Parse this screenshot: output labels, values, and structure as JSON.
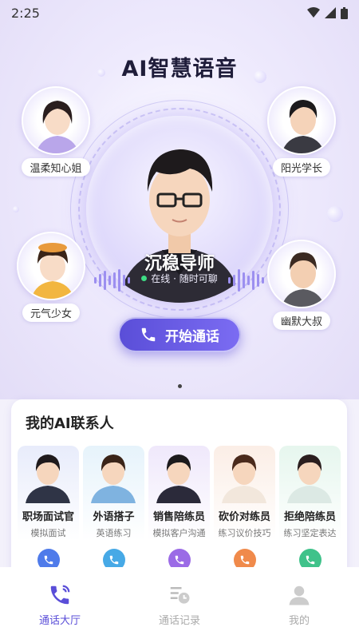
{
  "status_bar": {
    "time": "2:25"
  },
  "hero": {
    "title": "AI智慧语音",
    "main_character": {
      "name": "沉稳导师",
      "status": "在线 · 随时可聊"
    },
    "call_button_label": "开始通话",
    "side_characters": [
      {
        "label": "温柔知心姐"
      },
      {
        "label": "阳光学长"
      },
      {
        "label": "元气少女"
      },
      {
        "label": "幽默大叔"
      }
    ]
  },
  "contacts": {
    "title": "我的AI联系人",
    "items": [
      {
        "name": "职场面试官",
        "desc": "模拟面试",
        "bg": "#e8ecfb",
        "phone_color": "#4f7bea"
      },
      {
        "name": "外语搭子",
        "desc": "英语练习",
        "bg": "#e6f3fb",
        "phone_color": "#47a9e6"
      },
      {
        "name": "销售陪练员",
        "desc": "模拟客户沟通",
        "bg": "#efe8fb",
        "phone_color": "#9b6be6"
      },
      {
        "name": "砍价对练员",
        "desc": "练习议价技巧",
        "bg": "#fbeee6",
        "phone_color": "#f08a4b"
      },
      {
        "name": "拒绝陪练员",
        "desc": "练习坚定表达",
        "bg": "#e6f6ee",
        "phone_color": "#3fc28a"
      }
    ]
  },
  "tabbar": {
    "tabs": [
      {
        "label": "通话大厅",
        "icon": "phone-icon",
        "active": true
      },
      {
        "label": "通话记录",
        "icon": "history-icon",
        "active": false
      },
      {
        "label": "我的",
        "icon": "user-icon",
        "active": false
      }
    ]
  },
  "colors": {
    "accent": "#5a4ed8",
    "online": "#3ddc84"
  }
}
